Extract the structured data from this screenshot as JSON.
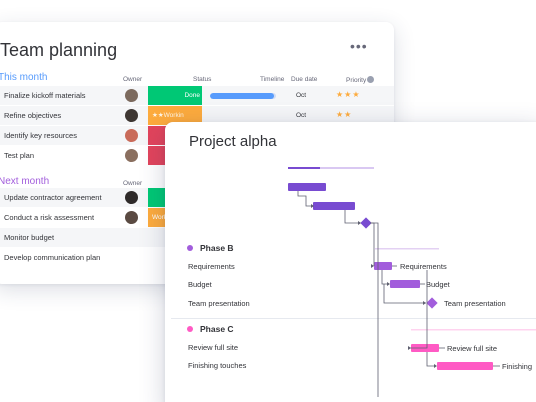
{
  "team_planning": {
    "title": "Team planning",
    "more_icon": "•••",
    "columns": {
      "owner": "Owner",
      "status": "Status",
      "timeline": "Timeline",
      "due_date": "Due date",
      "priority": "Priority"
    },
    "group1": {
      "title": "This month",
      "rows": [
        {
          "name": "Finalize kickoff materials",
          "status": "Done",
          "due": "Oct",
          "stars": "★★★"
        },
        {
          "name": "Refine objectives",
          "status": "★★Workin",
          "due": "Oct",
          "stars": "★★"
        },
        {
          "name": "Identify key resources",
          "status": "",
          "due": "",
          "stars": ""
        },
        {
          "name": "Test plan",
          "status": "",
          "due": "",
          "stars": ""
        }
      ]
    },
    "group2": {
      "title": "Next month",
      "owner_label": "Owner",
      "rows": [
        {
          "name": "Update contractor agreement",
          "status": ""
        },
        {
          "name": "Conduct a risk assessment",
          "status": "Worki"
        },
        {
          "name": "Monitor budget",
          "status": ""
        },
        {
          "name": "Develop communication plan",
          "status": ""
        }
      ]
    },
    "colors": {
      "done": "#00c875",
      "working": "#fdab3d",
      "stuck": "#e2445c",
      "timeline": "#579bfc"
    },
    "timeline_fill": 0.97
  },
  "project_alpha": {
    "title": "Project alpha",
    "phases": [
      {
        "name": "Phase B",
        "color": "#a25ddc",
        "tasks": [
          {
            "name": "Requirements",
            "bar_label": "Requirements"
          },
          {
            "name": "Budget",
            "bar_label": "Budget"
          },
          {
            "name": "Team presentation",
            "bar_label": "Team presentation"
          }
        ]
      },
      {
        "name": "Phase C",
        "color": "#ff5ac4",
        "tasks": [
          {
            "name": "Review full site",
            "bar_label": "Review full site"
          },
          {
            "name": "Finishing touches",
            "bar_label": "Finishing"
          }
        ]
      }
    ],
    "colors": {
      "phase_a": "#784bd1",
      "phase_b": "#a25ddc",
      "phase_c": "#ff5ac4",
      "connector": "#5f6070"
    }
  }
}
